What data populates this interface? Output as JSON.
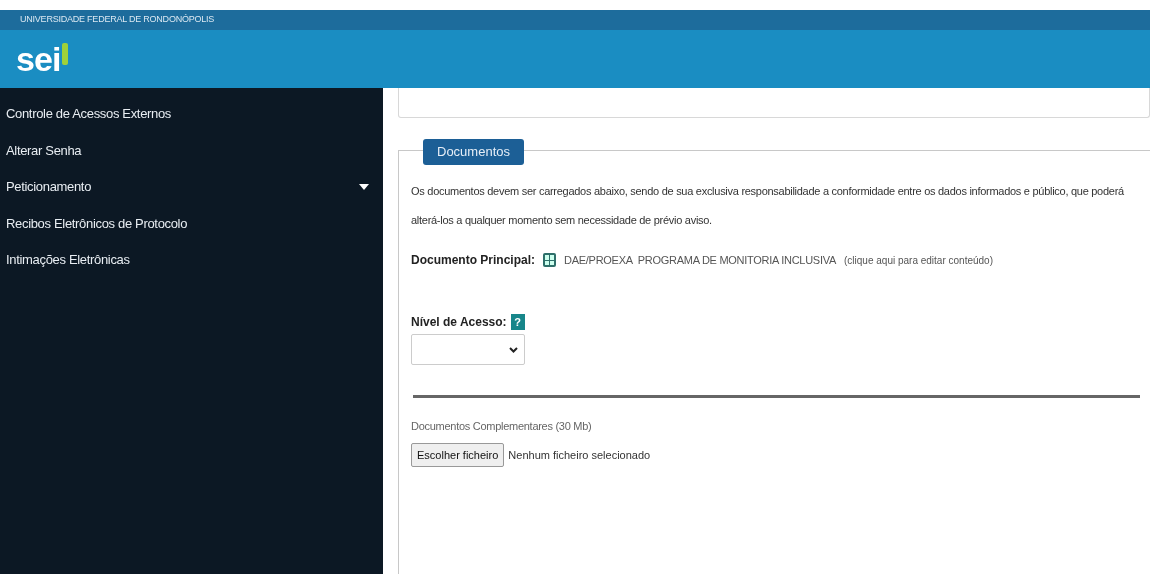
{
  "header": {
    "institution": "UNIVERSIDADE FEDERAL DE RONDONÓPOLIS",
    "logo": "sei"
  },
  "sidebar": {
    "items": [
      {
        "label": "Controle de Acessos Externos",
        "kind": "link"
      },
      {
        "label": "Alterar Senha",
        "kind": "link"
      },
      {
        "label": "Peticionamento",
        "kind": "submenu"
      },
      {
        "label": "Recibos Eletrônicos de Protocolo",
        "kind": "link"
      },
      {
        "label": "Intimações Eletrônicas",
        "kind": "link"
      }
    ]
  },
  "documents": {
    "legend": "Documentos",
    "notice": "Os documentos devem ser carregados abaixo, sendo de sua exclusiva responsabilidade a conformidade entre os dados informados e público, que poderá alterá-los a qualquer momento sem necessidade de prévio aviso.",
    "main_label": "Documento Principal:",
    "main_document": "DAE/PROEXA  PROGRAMA DE MONITORIA INCLUSIVA",
    "edit_link": "(clique aqui para editar conteúdo)",
    "access_label": "Nível de Acesso:",
    "help": "?",
    "complementary_label": "Documentos Complementares (30 Mb)",
    "file_button": "Escolher ficheiro",
    "file_status": "Nenhum ficheiro selecionado"
  }
}
